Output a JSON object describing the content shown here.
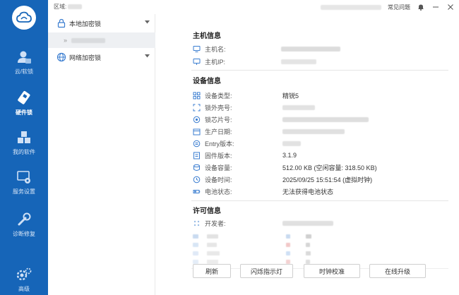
{
  "leftnav": {
    "items": [
      {
        "label": "云/软锁",
        "icon": "cloud-user-icon"
      },
      {
        "label": "硬件锁",
        "icon": "usb-key-icon",
        "active": true
      },
      {
        "label": "我的软件",
        "icon": "cubes-icon"
      },
      {
        "label": "服务设置",
        "icon": "service-settings-icon"
      },
      {
        "label": "诊断修复",
        "icon": "wrench-icon"
      },
      {
        "label": "高级",
        "icon": "gear-icon"
      }
    ]
  },
  "topbar": {
    "region_label": "区域:",
    "faq_label": "常见问题"
  },
  "tree": {
    "local_lock": "本地加密锁",
    "network_lock": "网络加密锁",
    "sub_arrow": "»"
  },
  "host_info": {
    "title": "主机信息",
    "hostname_label": "主机名:",
    "ip_label": "主机IP:"
  },
  "device_info": {
    "title": "设备信息",
    "rows": [
      {
        "label": "设备类型:",
        "value": "精锐5"
      },
      {
        "label": "锁外壳号:",
        "value": ""
      },
      {
        "label": "锁芯片号:",
        "value": ""
      },
      {
        "label": "生产日期:",
        "value": ""
      },
      {
        "label": "Entry版本:",
        "value": ""
      },
      {
        "label": "固件版本:",
        "value": "3.1.9"
      },
      {
        "label": "设备容量:",
        "value": "512.00 KB  (空闲容量: 318.50 KB)"
      },
      {
        "label": "设备时间:",
        "value": "2025/09/25 15:51:54 (虚拟时钟)"
      },
      {
        "label": "电池状态:",
        "value": "无法获得电池状态"
      }
    ]
  },
  "license_info": {
    "title": "许可信息",
    "developer_label": "开发者:"
  },
  "buttons": {
    "refresh": "刷新",
    "blink": "闪烁指示灯",
    "clock_sync": "时钟校准",
    "online_upgrade": "在线升级"
  },
  "colors": {
    "nav_bg": "#1665b8",
    "icon_blue": "#3a7dd0"
  }
}
